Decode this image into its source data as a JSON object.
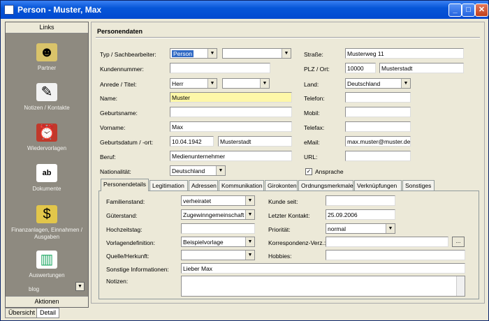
{
  "window": {
    "title": "Person - Muster, Max"
  },
  "left_panel": {
    "header": "Links",
    "items": [
      {
        "label": "Partner",
        "icon": "partner-icon"
      },
      {
        "label": "Notizen / Kontakte",
        "icon": "notes-icon"
      },
      {
        "label": "Wiedervorlagen",
        "icon": "alarm-clock-icon"
      },
      {
        "label": "Dokumente",
        "icon": "document-icon"
      },
      {
        "label": "Finanzanlagen, Einnahmen / Ausgaben",
        "icon": "finance-icon"
      },
      {
        "label": "Auswertungen",
        "icon": "chart-icon"
      }
    ],
    "extra_item": "blog",
    "footer": "Aktionen"
  },
  "bottom_tabs": [
    "Übersicht",
    "Detail"
  ],
  "section_title": "Personendaten",
  "fields": {
    "typ_label": "Typ / Sachbearbeiter:",
    "typ_value": "Person",
    "sachbearbeiter_value": "",
    "kundennummer_label": "Kundennummer:",
    "kundennummer_value": "",
    "anrede_label": "Anrede / Titel:",
    "anrede_value": "Herr",
    "titel_value": "",
    "name_label": "Name:",
    "name_value": "Muster",
    "geburtsname_label": "Geburtsname:",
    "geburtsname_value": "",
    "vorname_label": "Vorname:",
    "vorname_value": "Max",
    "geburtsdatum_label": "Geburtsdatum / -ort:",
    "geburtsdatum_value": "10.04.1942",
    "geburtsort_value": "Musterstadt",
    "beruf_label": "Beruf:",
    "beruf_value": "Medienunternehmer",
    "nationalitaet_label": "Nationalität:",
    "nationalitaet_value": "Deutschland",
    "strasse_label": "Straße:",
    "strasse_value": "Musterweg 11",
    "plz_label": "PLZ / Ort:",
    "plz_value": "10000",
    "ort_value": "Musterstadt",
    "land_label": "Land:",
    "land_value": "Deutschland",
    "telefon_label": "Telefon:",
    "telefon_value": "",
    "mobil_label": "Mobil:",
    "mobil_value": "",
    "telefax_label": "Telefax:",
    "telefax_value": "",
    "email_label": "eMail:",
    "email_value": "max.muster@muster.de",
    "url_label": "URL:",
    "url_value": "",
    "ansprache_label": "Ansprache",
    "ansprache_checked": "✓"
  },
  "tabs": [
    "Personendetails",
    "Legitimation",
    "Adressen",
    "Kommunikation",
    "Girokonten",
    "Ordnungsmerkmale",
    "Verknüpfungen",
    "Sonstiges"
  ],
  "details": {
    "familienstand_label": "Familienstand:",
    "familienstand_value": "verheiratet",
    "gueterstand_label": "Güterstand:",
    "gueterstand_value": "Zugewinngemeinschaft",
    "hochzeitstag_label": "Hochzeitstag:",
    "hochzeitstag_value": "",
    "vorlagendefinition_label": "Vorlagendefinition:",
    "vorlagendefinition_value": "Beispielvorlage",
    "quelle_label": "Quelle/Herkunft:",
    "quelle_value": "",
    "kunde_seit_label": "Kunde seit:",
    "kunde_seit_value": "",
    "letzter_kontakt_label": "Letzter Kontakt:",
    "letzter_kontakt_value": "25.09.2006",
    "prioritaet_label": "Priorität:",
    "prioritaet_value": "normal",
    "korrespondenz_label": "Korrespondenz-Verz.:",
    "korrespondenz_value": "",
    "browse_button": "...",
    "hobbies_label": "Hobbies:",
    "hobbies_value": "",
    "sonstige_label": "Sonstige Informationen:",
    "sonstige_value": "Lieber Max",
    "notizen_label": "Notizen:",
    "notizen_value": ""
  }
}
